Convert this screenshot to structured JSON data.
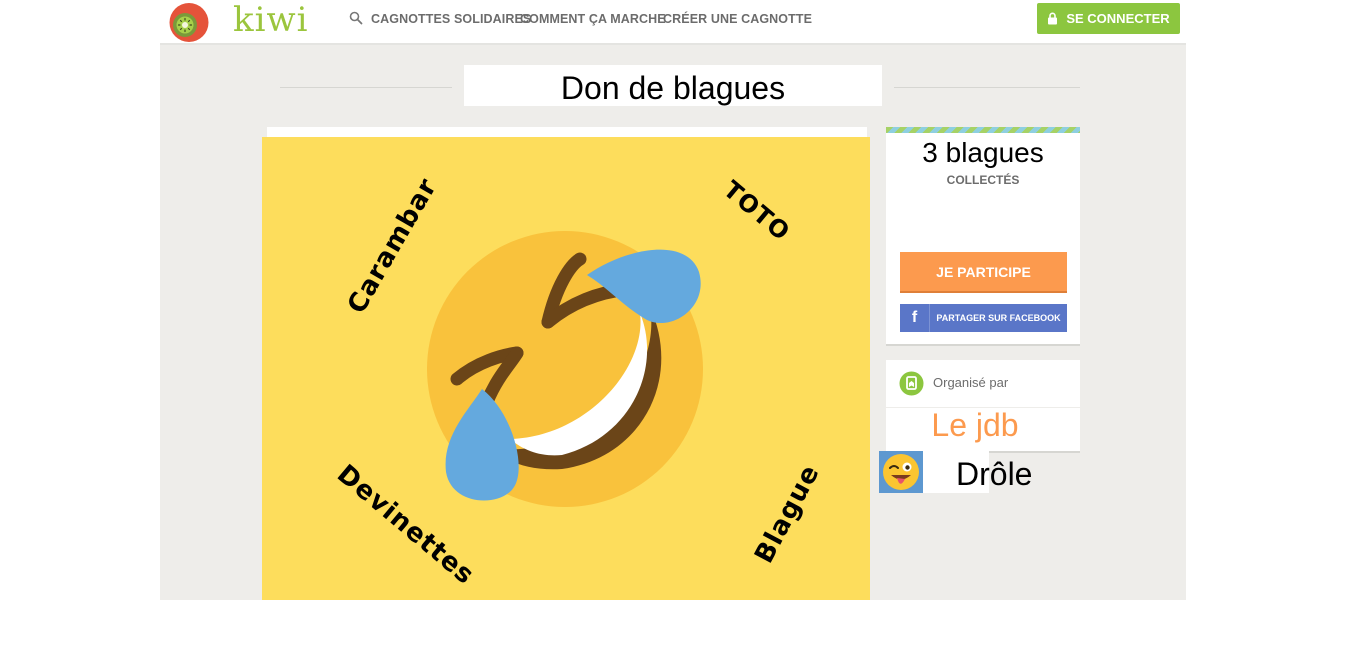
{
  "brand": {
    "name": "kiwi",
    "color": "#9bc53d"
  },
  "nav": {
    "search_icon": "search-icon",
    "items": [
      "CAGNOTTES SOLIDAIRES",
      "COMMENT ÇA MARCHE",
      "CRÉER UNE CAGNOTTE"
    ],
    "login_label": "SE CONNECTER",
    "login_icon": "lock-icon"
  },
  "page": {
    "title": "Don de blagues",
    "image_words": [
      "Carambar",
      "TOTO",
      "Devinettes",
      "Blague"
    ],
    "image_icon": "rolling-laughing-emoji-icon"
  },
  "sidebar": {
    "count": "3 blagues",
    "count_label": "COLLECTÉS",
    "participate_label": "JE PARTICIPE",
    "facebook_label": "PARTAGER SUR FACEBOOK",
    "facebook_icon": "facebook-icon",
    "organizer_label": "Organisé par",
    "organizer_icon": "badge-icon",
    "organizer_name": "Le jdb",
    "tag_label": "Drôle",
    "tag_icon": "winking-tongue-emoji-icon"
  },
  "colors": {
    "accent_green": "#8cc63f",
    "accent_orange": "#fc9a4e",
    "facebook": "#5a76c8",
    "image_bg": "#fddd5c"
  }
}
